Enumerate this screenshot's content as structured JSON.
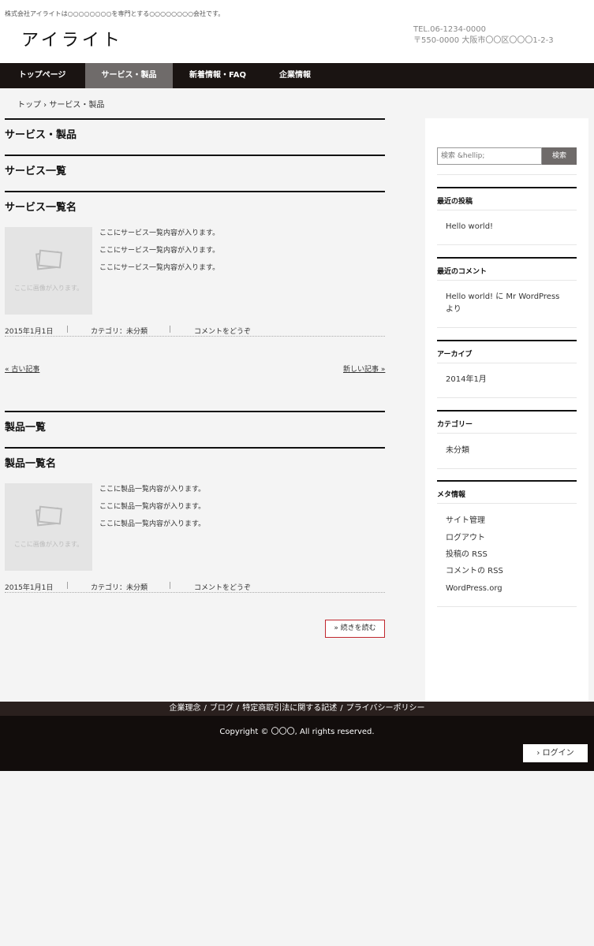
{
  "header": {
    "tagline": "株式会社アイライトは○○○○○○○○を専門とする○○○○○○○○会社です。",
    "logo": "アイライト",
    "tel": "TEL.06-1234-0000",
    "address": "〒550-0000 大阪市〇〇区〇〇〇1-2-3"
  },
  "nav": {
    "items": [
      {
        "label": "トップページ"
      },
      {
        "label": "サービス・製品"
      },
      {
        "label": "新着情報・FAQ"
      },
      {
        "label": "企業情報"
      }
    ]
  },
  "breadcrumb": "トップ › サービス・製品",
  "main": {
    "page_title": "サービス・製品",
    "service_section_title": "サービス一覧",
    "service_post": {
      "title": "サービス一覧名",
      "image_caption": "ここに画像が入ります。",
      "lines": [
        "ここにサービス一覧内容が入ります。",
        "ここにサービス一覧内容が入ります。",
        "ここにサービス一覧内容が入ります。"
      ],
      "date": "2015年1月1日",
      "category": "カテゴリ：未分類",
      "comment": "コメントをどうぞ"
    },
    "pager": {
      "older": "« 古い記事",
      "newer": "新しい記事 »"
    },
    "product_section_title": "製品一覧",
    "product_post": {
      "title": "製品一覧名",
      "image_caption": "ここに画像が入ります。",
      "lines": [
        "ここに製品一覧内容が入ります。",
        "ここに製品一覧内容が入ります。",
        "ここに製品一覧内容が入ります。"
      ],
      "date": "2015年1月1日",
      "category": "カテゴリ：未分類",
      "comment": "コメントをどうぞ"
    },
    "separator": "|",
    "read_more": "» 続きを読む"
  },
  "sidebar": {
    "search_placeholder": "検索 &hellip;",
    "search_button": "検索",
    "recent_posts_title": "最近の投稿",
    "recent_posts": [
      "Hello world!"
    ],
    "recent_comments_title": "最近のコメント",
    "recent_comment_line1": "Hello world! に Mr WordPress",
    "recent_comment_line2": "より",
    "archives_title": "アーカイブ",
    "archives": [
      "2014年1月"
    ],
    "categories_title": "カテゴリー",
    "categories": [
      "未分類"
    ],
    "meta_title": "メタ情報",
    "meta_items": [
      "サイト管理",
      "ログアウト",
      "投稿の RSS",
      "コメントの RSS",
      "WordPress.org"
    ]
  },
  "footer": {
    "links": [
      "企業理念",
      "ブログ",
      "特定商取引法に関する記述",
      "プライバシーポリシー"
    ],
    "link_separator": "/",
    "copyright": "Copyright © 〇〇〇, All rights reserved.",
    "login": "› ログイン"
  }
}
